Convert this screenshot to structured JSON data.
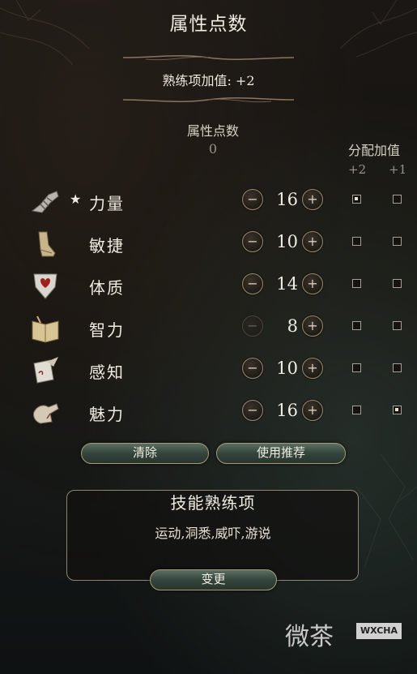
{
  "header": {
    "title": "属性点数",
    "proficiency_text": "熟练项加值: +2"
  },
  "points": {
    "label": "属性点数",
    "value": "0"
  },
  "allocation": {
    "label": "分配加值",
    "col1": "+2",
    "col2": "+1"
  },
  "attributes": [
    {
      "name": "力量",
      "value": "16",
      "starred": true,
      "icon": "gauntlet-icon",
      "minus_enabled": true,
      "plus_enabled": true,
      "bonus2": true,
      "bonus1": false
    },
    {
      "name": "敏捷",
      "value": "10",
      "starred": false,
      "icon": "boot-icon",
      "minus_enabled": true,
      "plus_enabled": true,
      "bonus2": false,
      "bonus1": false
    },
    {
      "name": "体质",
      "value": "14",
      "starred": false,
      "icon": "heart-shield-icon",
      "minus_enabled": true,
      "plus_enabled": true,
      "bonus2": false,
      "bonus1": false
    },
    {
      "name": "智力",
      "value": "8",
      "starred": false,
      "icon": "book-icon",
      "minus_enabled": false,
      "plus_enabled": true,
      "bonus2": false,
      "bonus1": false
    },
    {
      "name": "感知",
      "value": "10",
      "starred": false,
      "icon": "scroll-quill-icon",
      "minus_enabled": true,
      "plus_enabled": true,
      "bonus2": false,
      "bonus1": false
    },
    {
      "name": "魅力",
      "value": "16",
      "starred": false,
      "icon": "hand-icon",
      "minus_enabled": true,
      "plus_enabled": true,
      "bonus2": false,
      "bonus1": true
    }
  ],
  "actions": {
    "clear_label": "清除",
    "recommend_label": "使用推荐"
  },
  "skills": {
    "title": "技能熟练项",
    "list": "运动,洞悉,威吓,游说",
    "change_label": "变更"
  },
  "symbols": {
    "star": "★",
    "minus": "−",
    "plus": "+"
  },
  "watermark": {
    "text": "微茶",
    "badge": "WXCHA"
  },
  "colors": {
    "accent_border": "#a89a76",
    "button_green": "#34453c",
    "text": "#f1ece2"
  }
}
